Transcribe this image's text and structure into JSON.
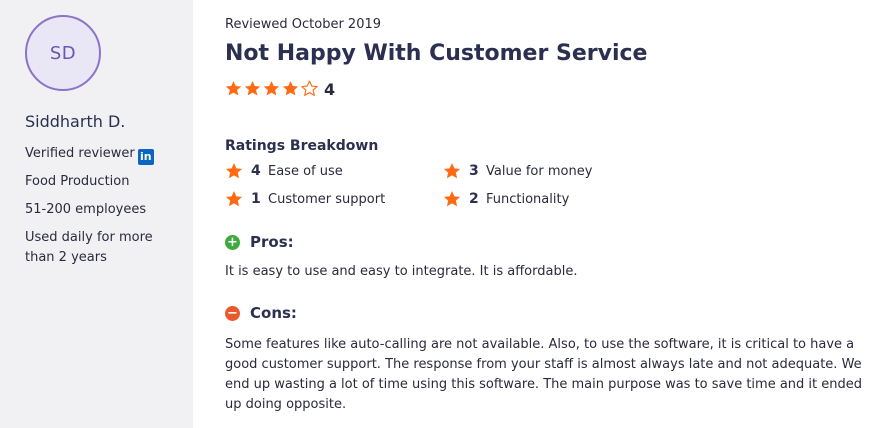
{
  "reviewer": {
    "initials": "SD",
    "name": "Siddharth D.",
    "verified_label": "Verified reviewer",
    "linkedin_icon": "linkedin-icon",
    "industry": "Food Production",
    "company_size": "51-200 employees",
    "usage": "Used daily for more than 2 years"
  },
  "review": {
    "date": "Reviewed October 2019",
    "title": "Not Happy With Customer Service",
    "overall_rating": 4,
    "overall_rating_label": "4",
    "star_color": "#ff6a13",
    "breakdown_heading": "Ratings Breakdown",
    "breakdown": [
      {
        "value": "4",
        "label": "Ease of use"
      },
      {
        "value": "3",
        "label": "Value for money"
      },
      {
        "value": "1",
        "label": "Customer support"
      },
      {
        "value": "2",
        "label": "Functionality"
      }
    ],
    "pros": {
      "title": "Pros:",
      "icon": "plus-circle-icon",
      "color": "#3daa3d",
      "text": "It is easy to use and easy to integrate. It is affordable."
    },
    "cons": {
      "title": "Cons:",
      "icon": "minus-circle-icon",
      "color": "#e85a2e",
      "text": "Some features like auto-calling are not available. Also, to use the software, it is critical to have a good customer support. The response from your staff is almost always late and not adequate. We end up wasting a lot of time using this software. The main purpose was to save time and it ended up doing opposite."
    }
  }
}
